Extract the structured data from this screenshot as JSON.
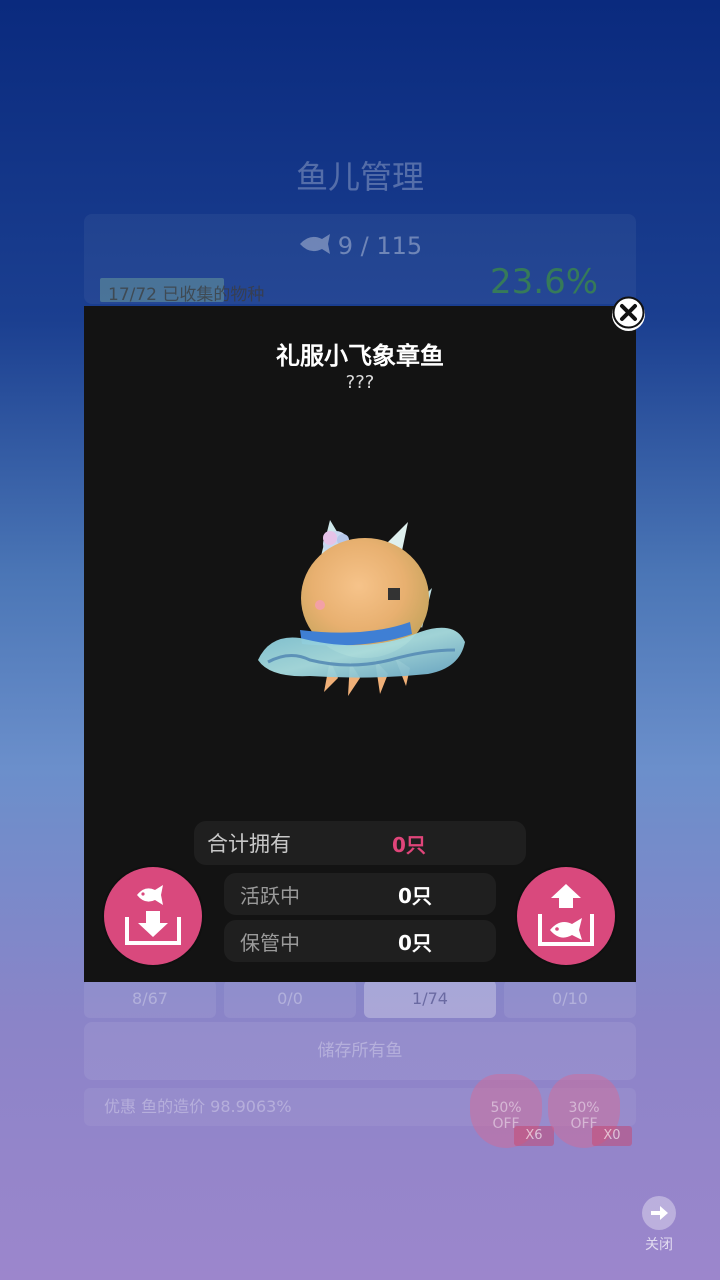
{
  "background": {
    "title": "鱼儿管理",
    "fish_count": "9 / 115",
    "collected_species": "17/72 已收集的物种",
    "collection_percent": "23.6%",
    "tabs": [
      {
        "label": "8/67"
      },
      {
        "label": "0/0"
      },
      {
        "label": "1/74"
      },
      {
        "label": "0/10"
      }
    ],
    "store_all_button": "储存所有鱼",
    "discount_text": "优惠 鱼的造价 98.9063%",
    "coupons": [
      {
        "text": "50%",
        "sub": "OFF",
        "count": "X6"
      },
      {
        "text": "30%",
        "sub": "OFF",
        "count": "X0"
      }
    ],
    "close_label": "关闭"
  },
  "modal": {
    "fish_name": "礼服小飞象章鱼",
    "fish_subtitle": "???",
    "total_owned_label": "合计拥有",
    "total_owned_value": "0只",
    "active_label": "活跃中",
    "active_value": "0只",
    "stored_label": "保管中",
    "stored_value": "0只"
  },
  "colors": {
    "accent_pink": "#d9497d",
    "value_pink": "#e0457a",
    "modal_bg": "#131313"
  },
  "icons": {
    "close": "close-x-icon",
    "store": "store-fish-icon",
    "release": "release-fish-icon"
  }
}
